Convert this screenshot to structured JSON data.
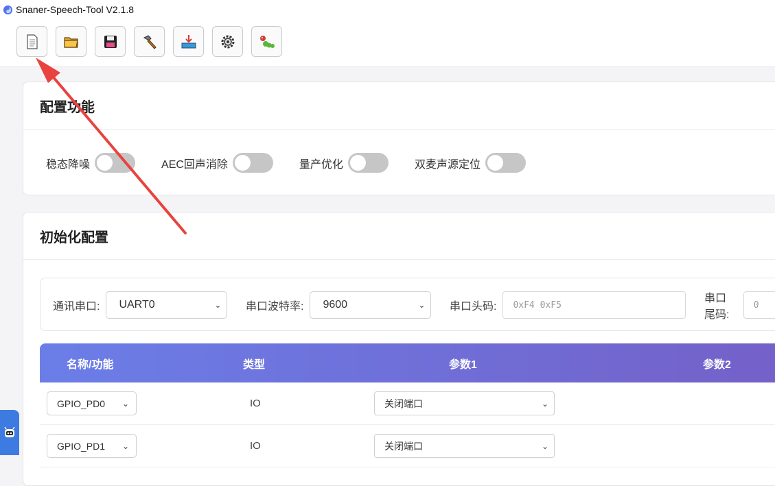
{
  "window": {
    "title": "Snaner-Speech-Tool V2.1.8"
  },
  "toolbar": {
    "buttons": [
      {
        "icon": "new-file-icon"
      },
      {
        "icon": "open-folder-icon"
      },
      {
        "icon": "save-icon"
      },
      {
        "icon": "hammer-icon"
      },
      {
        "icon": "download-icon"
      },
      {
        "icon": "gear-icon"
      },
      {
        "icon": "bug-icon"
      }
    ]
  },
  "config": {
    "title": "配置功能",
    "switches": [
      {
        "label": "稳态降噪",
        "on": false
      },
      {
        "label": "AEC回声消除",
        "on": false
      },
      {
        "label": "量产优化",
        "on": false
      },
      {
        "label": "双麦声源定位",
        "on": false
      }
    ]
  },
  "init": {
    "title": "初始化配置",
    "serial_port_label": "通讯串口:",
    "serial_port_value": "UART0",
    "baud_label": "串口波特率:",
    "baud_value": "9600",
    "header_label": "串口头码:",
    "header_placeholder": "0xF4 0xF5",
    "tail_label": "串口尾码:",
    "tail_placeholder": "0"
  },
  "table": {
    "columns": [
      "名称/功能",
      "类型",
      "参数1",
      "参数2"
    ],
    "rows": [
      {
        "name": "GPIO_PD0",
        "type": "IO",
        "param1": "关闭端口"
      },
      {
        "name": "GPIO_PD1",
        "type": "IO",
        "param1": "关闭端口"
      }
    ]
  },
  "colors": {
    "header_gradient_start": "#6b7ee8",
    "header_gradient_end": "#7460c8",
    "arrow": "#e8433f",
    "float_button": "#3d7be0"
  }
}
